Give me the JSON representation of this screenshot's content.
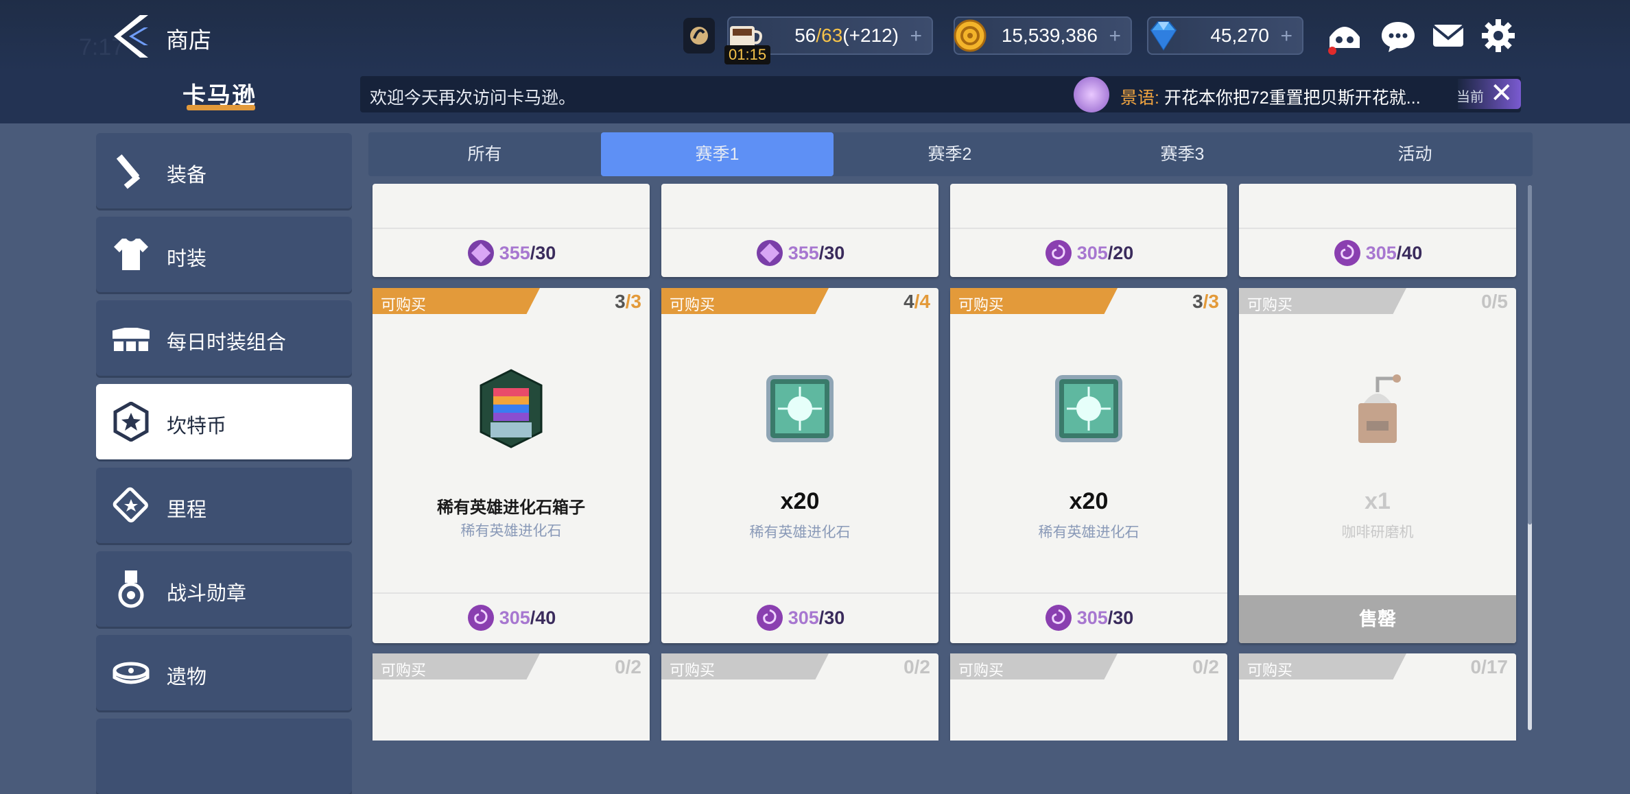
{
  "header": {
    "title": "商店",
    "ghost_time": "7:17",
    "stamina": {
      "current": "56",
      "max": "63",
      "bonus": "(+212)",
      "timer": "01:15"
    },
    "gold": "15,539,386",
    "gems": "45,270",
    "plus": "+"
  },
  "logo": {
    "text": "卡马逊"
  },
  "notice": {
    "message": "欢迎今天再次访问卡马逊。",
    "speaker": "景语:",
    "chat": "开花本你把72重置把贝斯开花就...",
    "current_label": "当前",
    "close": "✕"
  },
  "sidebar": {
    "items": [
      {
        "label": "装备",
        "icon": "sword-icon"
      },
      {
        "label": "时装",
        "icon": "shirt-icon"
      },
      {
        "label": "每日时装组合",
        "icon": "outfit-bundle-icon"
      },
      {
        "label": "坎特币",
        "icon": "kanter-coin-icon",
        "active": true
      },
      {
        "label": "里程",
        "icon": "ticket-icon"
      },
      {
        "label": "战斗勋章",
        "icon": "medal-icon"
      },
      {
        "label": "遗物",
        "icon": "relic-icon"
      }
    ]
  },
  "tabs": [
    "所有",
    "赛季1",
    "赛季2",
    "赛季3",
    "活动"
  ],
  "active_tab": "赛季1",
  "top_prices": [
    {
      "price": "355",
      "limit": "/30",
      "coin": "purple-diamond-coin"
    },
    {
      "price": "355",
      "limit": "/30",
      "coin": "purple-diamond-coin"
    },
    {
      "price": "305",
      "limit": "/20",
      "coin": "purple-swirl-coin"
    },
    {
      "price": "305",
      "limit": "/40",
      "coin": "purple-swirl-coin"
    }
  ],
  "cards": [
    {
      "ribbon": "可购买",
      "count": "3",
      "total": "/3",
      "name": "稀有英雄进化石箱子",
      "sub": "稀有英雄进化石",
      "price": "305",
      "limit": "/40",
      "item_icon": "rainbow-stone-box-icon"
    },
    {
      "ribbon": "可购买",
      "count": "4",
      "total": "/4",
      "qty": "x20",
      "sub": "稀有英雄进化石",
      "price": "305",
      "limit": "/30",
      "item_icon": "evolution-stone-icon"
    },
    {
      "ribbon": "可购买",
      "count": "3",
      "total": "/3",
      "qty": "x20",
      "sub": "稀有英雄进化石",
      "price": "305",
      "limit": "/30",
      "item_icon": "evolution-stone-icon"
    },
    {
      "ribbon": "可购买",
      "count": "0",
      "total": "/5",
      "qty": "x1",
      "sub": "咖啡研磨机",
      "soldout": "售罄",
      "item_icon": "coffee-grinder-icon"
    }
  ],
  "bottom_cards": [
    {
      "ribbon": "可购买",
      "count": "0",
      "total": "/2"
    },
    {
      "ribbon": "可购买",
      "count": "0",
      "total": "/2"
    },
    {
      "ribbon": "可购买",
      "count": "0",
      "total": "/2"
    },
    {
      "ribbon": "可购买",
      "count": "0",
      "total": "/17"
    }
  ],
  "colors": {
    "accent_orange": "#e39a3a",
    "tab_active": "#5e90f5",
    "price_purple": "#a777d0",
    "sidebar": "#3e5072"
  }
}
